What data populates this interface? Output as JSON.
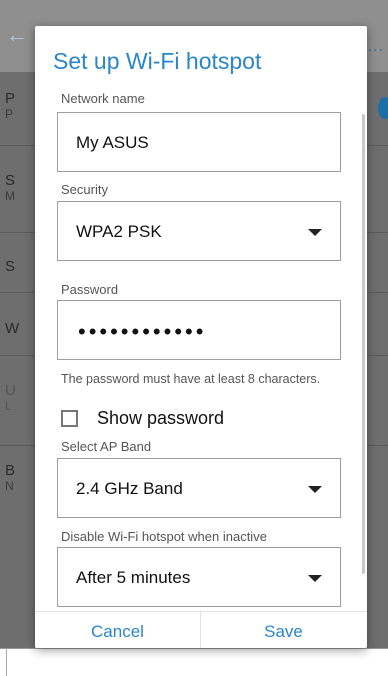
{
  "background": {
    "rows": [
      {
        "title": "P",
        "subtitle": "P"
      },
      {
        "title": "S",
        "subtitle": "M"
      },
      {
        "title": "S",
        "subtitle": ""
      },
      {
        "title": "W",
        "subtitle": ""
      },
      {
        "title": "U",
        "subtitle": "L"
      },
      {
        "title": "B",
        "subtitle": "N"
      }
    ],
    "more": "..."
  },
  "dialog": {
    "title": "Set up Wi-Fi hotspot",
    "network_name": {
      "label": "Network name",
      "value": "My ASUS"
    },
    "security": {
      "label": "Security",
      "value": "WPA2 PSK"
    },
    "password": {
      "label": "Password",
      "value": "••••••••••••"
    },
    "password_hint": "The password must have at least 8 characters.",
    "show_password": {
      "label": "Show password",
      "checked": false
    },
    "ap_band": {
      "label": "Select AP Band",
      "value": "2.4 GHz Band"
    },
    "disable_inactive": {
      "label": "Disable Wi-Fi hotspot when inactive",
      "value": "After 5 minutes"
    },
    "cancel_label": "Cancel",
    "save_label": "Save"
  },
  "colors": {
    "accent": "#2a86c7"
  }
}
